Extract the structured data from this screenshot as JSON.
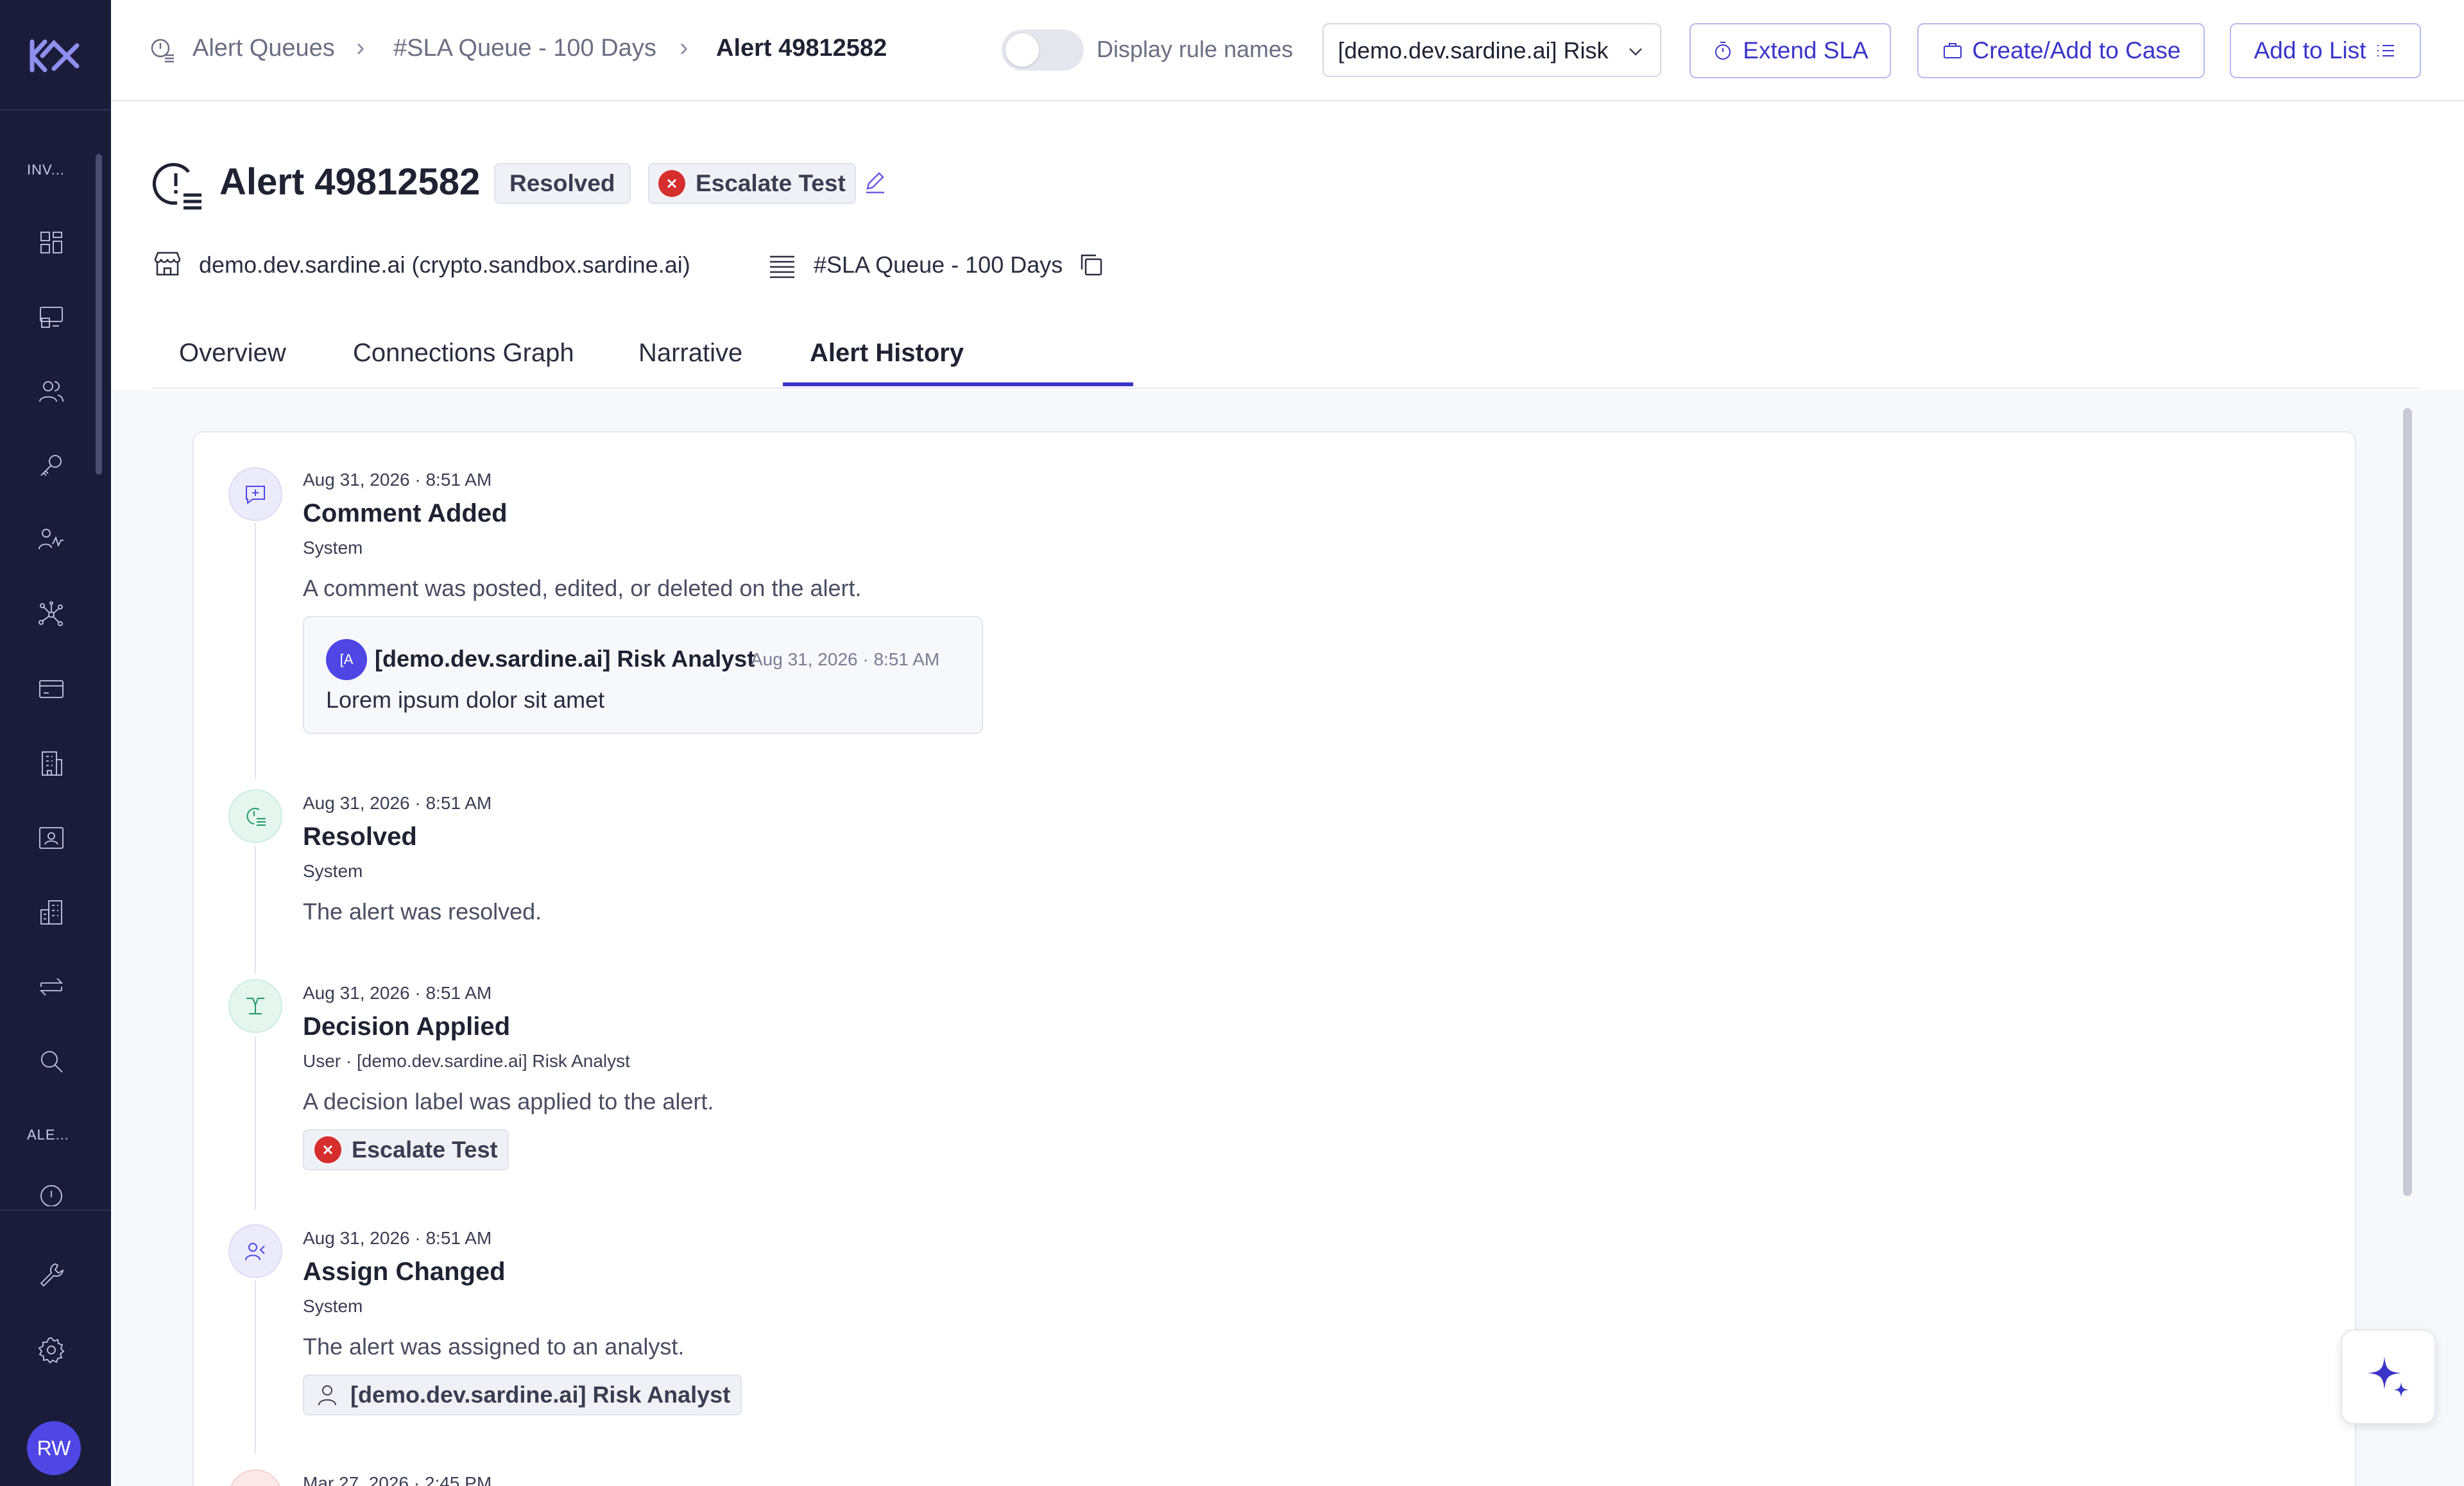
{
  "sidebar": {
    "section_investigations": "INV...",
    "section_alerts": "ALE...",
    "items": [
      {
        "icon": "dashboard-icon"
      },
      {
        "icon": "monitor-icon"
      },
      {
        "icon": "users-icon"
      },
      {
        "icon": "key-icon"
      },
      {
        "icon": "activity-icon"
      },
      {
        "icon": "network-icon"
      },
      {
        "icon": "card-icon"
      },
      {
        "icon": "building-icon"
      },
      {
        "icon": "id-card-icon"
      },
      {
        "icon": "business-icon"
      },
      {
        "icon": "transfer-icon"
      },
      {
        "icon": "search-icon"
      }
    ],
    "bottom": [
      {
        "icon": "wrench-icon"
      },
      {
        "icon": "gear-icon"
      }
    ],
    "avatar_initials": "RW"
  },
  "breadcrumb": {
    "items": [
      "Alert Queues",
      "#SLA Queue - 100 Days",
      "Alert 49812582"
    ]
  },
  "toolbar": {
    "toggle_label": "Display rule names",
    "toggle_on": false,
    "select_value": "[demo.dev.sardine.ai] Risk Analyst",
    "extend_sla": "Extend SLA",
    "create_case": "Create/Add to Case",
    "add_to_list": "Add to List"
  },
  "alert": {
    "title": "Alert 49812582",
    "status": "Resolved",
    "decision": "Escalate Test",
    "merchant": "demo.dev.sardine.ai (crypto.sandbox.sardine.ai)",
    "queue": "#SLA Queue - 100 Days"
  },
  "tabs": [
    {
      "label": "Overview",
      "active": false
    },
    {
      "label": "Connections Graph",
      "active": false
    },
    {
      "label": "Narrative",
      "active": false
    },
    {
      "label": "Alert History",
      "active": true
    }
  ],
  "history": [
    {
      "time": "Aug 31, 2026 · 8:51 AM",
      "title": "Comment Added",
      "actor": "System",
      "description": "A comment was posted, edited, or deleted on the alert.",
      "comment": {
        "avatar": "[A",
        "author": "[demo.dev.sardine.ai] Risk Analyst",
        "time": "Aug 31, 2026 · 8:51 AM",
        "text": "Lorem ipsum dolor sit amet"
      }
    },
    {
      "time": "Aug 31, 2026 · 8:51 AM",
      "title": "Resolved",
      "actor": "System",
      "description": "The alert was resolved."
    },
    {
      "time": "Aug 31, 2026 · 8:51 AM",
      "title": "Decision Applied",
      "actor": "User · [demo.dev.sardine.ai] Risk Analyst",
      "description": "A decision label was applied to the alert.",
      "chip": "Escalate Test"
    },
    {
      "time": "Aug 31, 2026 · 8:51 AM",
      "title": "Assign Changed",
      "actor": "System",
      "description": "The alert was assigned to an analyst.",
      "chip": "[demo.dev.sardine.ai] Risk Analyst"
    },
    {
      "time": "Mar 27, 2026 · 2:45 PM"
    }
  ],
  "colors": {
    "sidebar_bg": "#1b1c3a",
    "accent": "#3b34c9",
    "danger": "#d62d2d",
    "success": "#1d9a66"
  }
}
